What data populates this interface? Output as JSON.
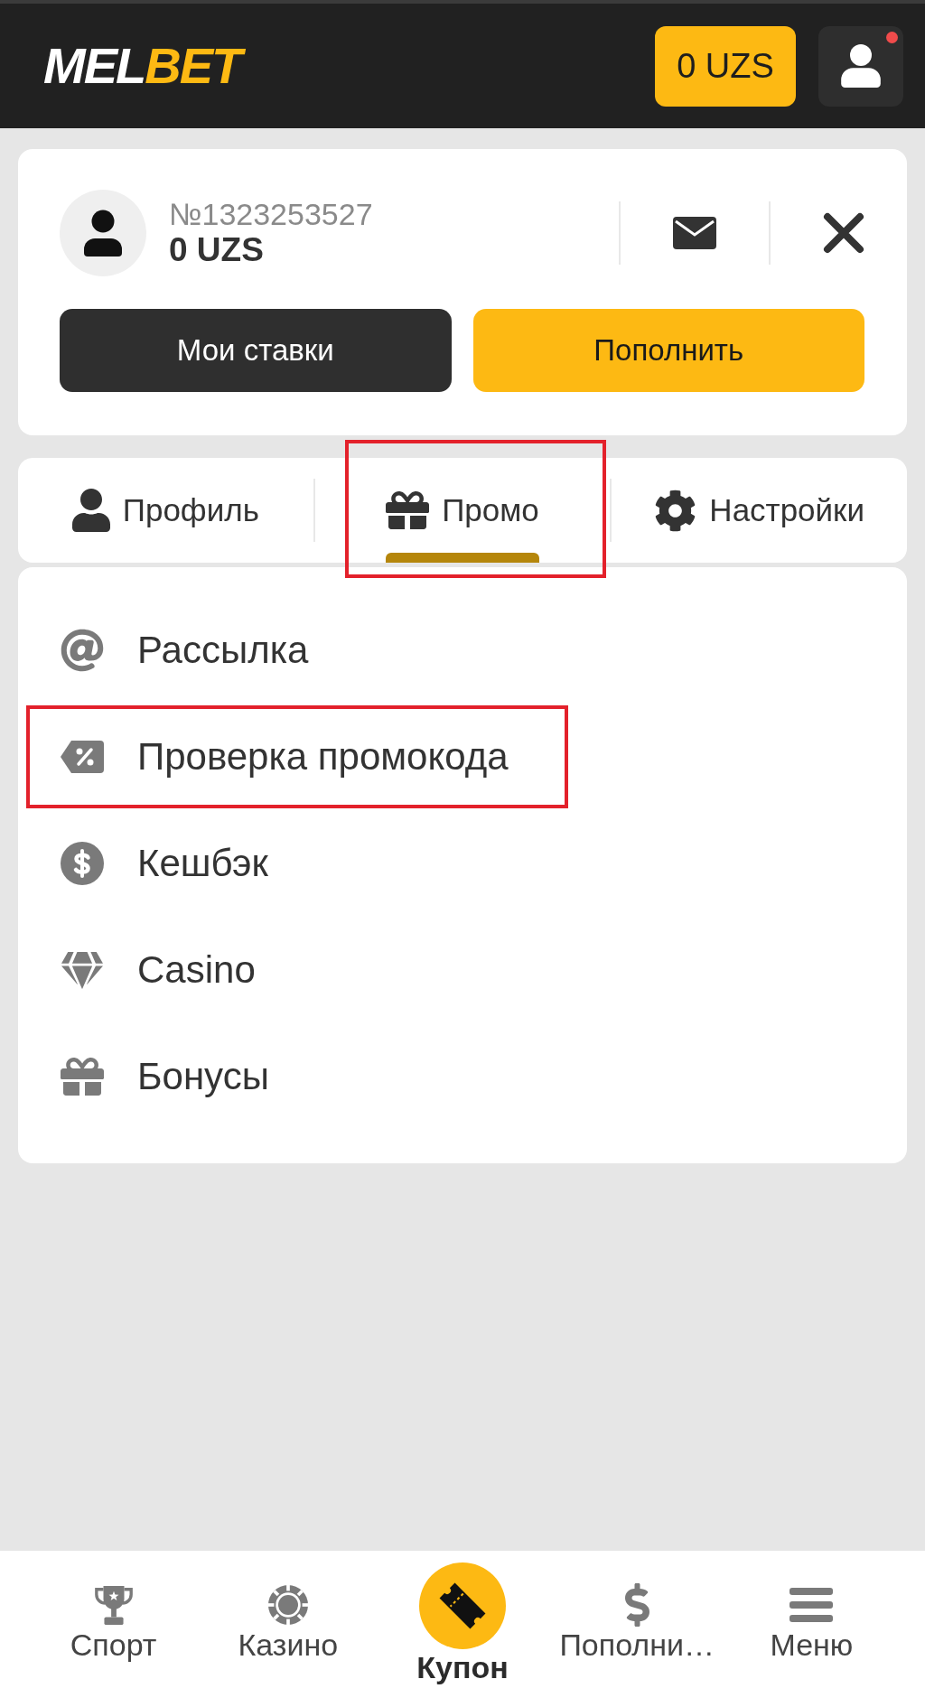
{
  "header": {
    "logo": [
      {
        "text": "MEL",
        "color": "#ffffff"
      },
      {
        "text": "BET",
        "color": "#fdb913"
      }
    ],
    "balance": "0 UZS",
    "notification": true
  },
  "account": {
    "number": "№1323253527",
    "balance": "0 UZS",
    "buttons": [
      {
        "label": "Мои ставки",
        "kind": "secondary"
      },
      {
        "label": "Пополнить",
        "kind": "primary"
      }
    ]
  },
  "tabs": [
    {
      "label": "Профиль",
      "selected": false,
      "highlighted": false
    },
    {
      "label": "Промо",
      "selected": true,
      "highlighted": true
    },
    {
      "label": "Настройки",
      "selected": false,
      "highlighted": false
    }
  ],
  "menu": [
    {
      "label": "Рассылка",
      "highlighted": false
    },
    {
      "label": "Проверка промокода",
      "highlighted": true
    },
    {
      "label": "Кешбэк",
      "highlighted": false
    },
    {
      "label": "Casino",
      "highlighted": false
    },
    {
      "label": "Бонусы",
      "highlighted": false
    }
  ],
  "bottom_nav": [
    {
      "label": "Спорт",
      "kind": "link"
    },
    {
      "label": "Казино",
      "kind": "link"
    },
    {
      "label": "Купон",
      "kind": "coupon"
    },
    {
      "label": "Пополни…",
      "kind": "link"
    },
    {
      "label": "Меню",
      "kind": "link"
    }
  ]
}
